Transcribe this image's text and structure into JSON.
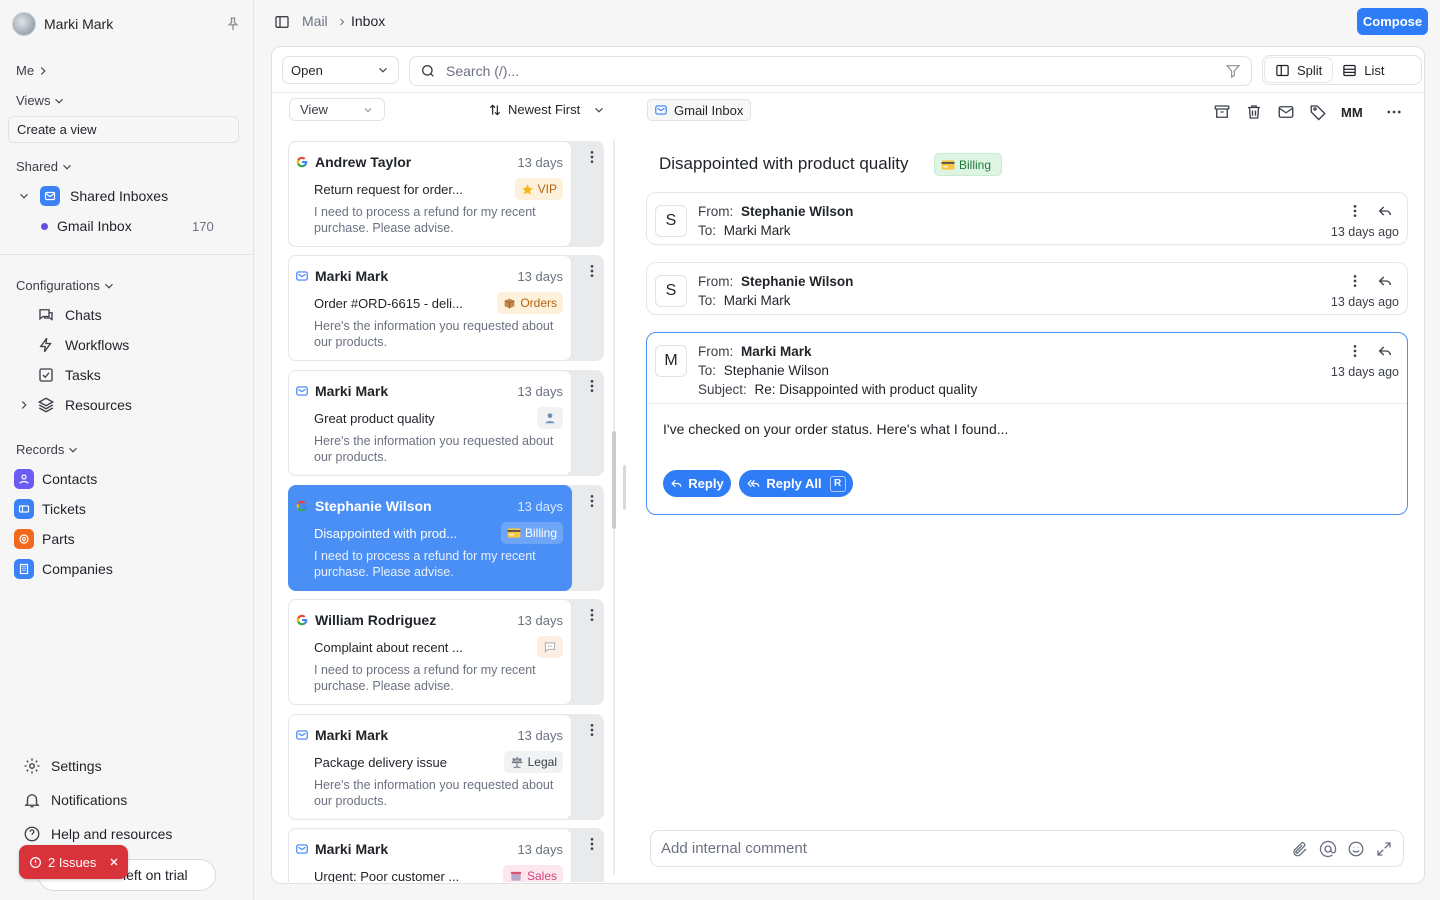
{
  "user": {
    "name": "Marki Mark"
  },
  "sidebar": {
    "me_label": "Me",
    "views_label": "Views",
    "create_view": "Create a view",
    "shared_label": "Shared",
    "shared_inboxes": "Shared Inboxes",
    "gmail_inbox": "Gmail Inbox",
    "gmail_count": "170",
    "configurations_label": "Configurations",
    "config_items": [
      "Chats",
      "Workflows",
      "Tasks",
      "Resources"
    ],
    "records_label": "Records",
    "records": [
      {
        "label": "Contacts",
        "color": "#6a5cf0"
      },
      {
        "label": "Tickets",
        "color": "#3b82f6"
      },
      {
        "label": "Parts",
        "color": "#f2681d"
      },
      {
        "label": "Companies",
        "color": "#3b82f6"
      }
    ],
    "bottom_items": [
      "Settings",
      "Notifications",
      "Help and resources"
    ],
    "trial_text": "left on trial",
    "issues_text": "2 Issues"
  },
  "topbar": {
    "breadcrumb": [
      "Mail",
      "Inbox"
    ],
    "compose": "Compose"
  },
  "toolbar": {
    "status": "Open",
    "search_placeholder": "Search (/)...",
    "split": "Split",
    "list": "List"
  },
  "list": {
    "view_label": "View",
    "sort_label": "Newest First",
    "cards": [
      {
        "sender": "Andrew Taylor",
        "source": "google",
        "days": "13 days",
        "subject": "Return request for order...",
        "tag": "VIP",
        "tag_icon": "star",
        "tag_bg": "#fdf1dc",
        "tag_fg": "#b5620c",
        "preview": "I need to process a refund for my recent purchase. Please advise.",
        "selected": false
      },
      {
        "sender": "Marki Mark",
        "source": "mail",
        "days": "13 days",
        "subject": "Order #ORD-6615 - deli...",
        "tag": "Orders",
        "tag_icon": "box",
        "tag_bg": "#fdf1dc",
        "tag_fg": "#b5620c",
        "preview": "Here's the information you requested about our products.",
        "selected": false
      },
      {
        "sender": "Marki Mark",
        "source": "mail",
        "days": "13 days",
        "subject": "Great product quality",
        "tag": "",
        "tag_icon": "person",
        "tag_bg": "#f1f2f4",
        "tag_fg": "#6b7280",
        "preview": "Here's the information you requested about our products.",
        "selected": false
      },
      {
        "sender": "Stephanie Wilson",
        "source": "google",
        "days": "13 days",
        "subject": "Disappointed with prod...",
        "tag": "Billing",
        "tag_icon": "card",
        "tag_bg": "#6ea5f7",
        "tag_fg": "#ffffff",
        "preview": "I need to process a refund for my recent purchase. Please advise.",
        "selected": true
      },
      {
        "sender": "William Rodriguez",
        "source": "google",
        "days": "13 days",
        "subject": "Complaint about recent ...",
        "tag": "",
        "tag_icon": "chat",
        "tag_bg": "#fdeee3",
        "tag_fg": "#c2410c",
        "preview": "I need to process a refund for my recent purchase. Please advise.",
        "selected": false
      },
      {
        "sender": "Marki Mark",
        "source": "mail",
        "days": "13 days",
        "subject": "Package delivery issue",
        "tag": "Legal",
        "tag_icon": "scale",
        "tag_bg": "#f1f2f4",
        "tag_fg": "#3b4048",
        "preview": "Here's the information you requested about our products.",
        "selected": false
      },
      {
        "sender": "Marki Mark",
        "source": "mail",
        "days": "13 days",
        "subject": "Urgent: Poor customer ...",
        "tag": "Sales",
        "tag_icon": "shop",
        "tag_bg": "#fde7ef",
        "tag_fg": "#d0457a",
        "preview": "",
        "selected": false
      }
    ]
  },
  "detail": {
    "inbox_chip": "Gmail Inbox",
    "assignee": "MM",
    "title": "Disappointed with product quality",
    "tag": "Billing",
    "from_label": "From:",
    "to_label": "To:",
    "subject_label": "Subject:",
    "messages": [
      {
        "avatar": "S",
        "from": "Stephanie Wilson",
        "to": "Marki Mark",
        "ago": "13 days ago"
      },
      {
        "avatar": "S",
        "from": "Stephanie Wilson",
        "to": "Marki Mark",
        "ago": "13 days ago"
      },
      {
        "avatar": "M",
        "from": "Marki Mark",
        "to": "Stephanie Wilson",
        "subject": "Re: Disappointed with product quality",
        "ago": "13 days ago",
        "body": "I've checked on your order status. Here's what I found..."
      }
    ],
    "reply": "Reply",
    "reply_all": "Reply All",
    "reply_all_key": "R",
    "comment_placeholder": "Add internal comment"
  }
}
